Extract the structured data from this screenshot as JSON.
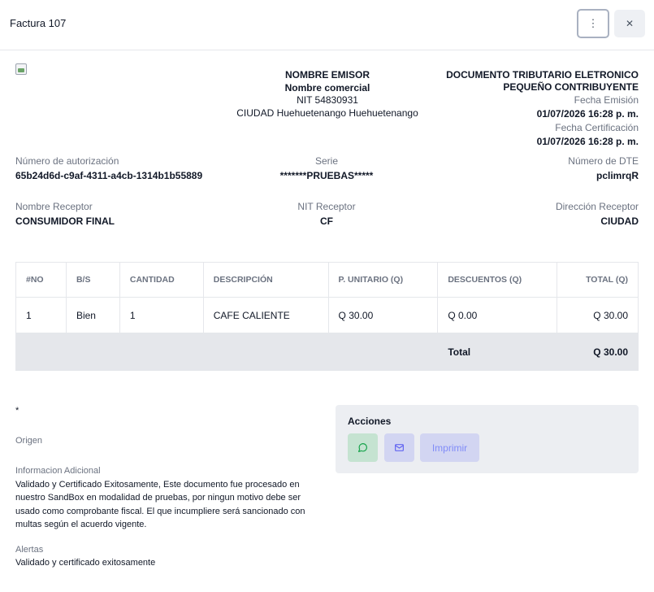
{
  "header": {
    "title": "Factura 107",
    "more_icon": "⋮",
    "close_icon": "✕"
  },
  "emisor": {
    "nombre": "NOMBRE EMISOR",
    "comercial": "Nombre comercial",
    "nit": "NIT 54830931",
    "ciudad": "CIUDAD Huehuetenango Huehuetenango"
  },
  "documento": {
    "tipo1": "DOCUMENTO TRIBUTARIO ELETRONICO",
    "tipo2": "PEQUEÑO CONTRIBUYENTE",
    "fecha_emision_label": "Fecha Emisión",
    "fecha_emision": "01/07/2026 16:28 p. m.",
    "fecha_cert_label": "Fecha Certificación",
    "fecha_cert": "01/07/2026 16:28 p. m."
  },
  "info": {
    "autorizacion_label": "Número de autorización",
    "autorizacion": "65b24d6d-c9af-4311-a4cb-1314b1b55889",
    "serie_label": "Serie",
    "serie": "*******PRUEBAS*****",
    "dte_label": "Número de DTE",
    "dte": "pclimrqR",
    "receptor_label": "Nombre Receptor",
    "receptor": "CONSUMIDOR FINAL",
    "nit_receptor_label": "NIT Receptor",
    "nit_receptor": "CF",
    "direccion_label": "Dirección Receptor",
    "direccion": "CIUDAD"
  },
  "table": {
    "headers": [
      "#NO",
      "B/S",
      "CANTIDAD",
      "DESCRIPCIÓN",
      "P. UNITARIO (Q)",
      "DESCUENTOS (Q)",
      "TOTAL (Q)"
    ],
    "rows": [
      [
        "1",
        "Bien",
        "1",
        "CAFE CALIENTE",
        "Q 30.00",
        "Q 0.00",
        "Q 30.00"
      ]
    ],
    "total_label": "Total",
    "total_value": "Q 30.00"
  },
  "notes": {
    "asterisk": "*",
    "origen_label": "Origen",
    "info_label": "Informacion Adicional",
    "info_text": "Validado y Certificado Exitosamente, Este documento fue procesado en nuestro SandBox en modalidad de pruebas, por ningun motivo debe ser usado como comprobante fiscal. El que incumpliere será sancionado con multas según el acuerdo vigente.",
    "alertas_label": "Alertas",
    "alertas_text": "Validado y certificado exitosamente"
  },
  "acciones": {
    "title": "Acciones",
    "print_label": "Imprimir",
    "whatsapp_icon": "whatsapp-icon",
    "mail_icon": "mail-icon"
  }
}
